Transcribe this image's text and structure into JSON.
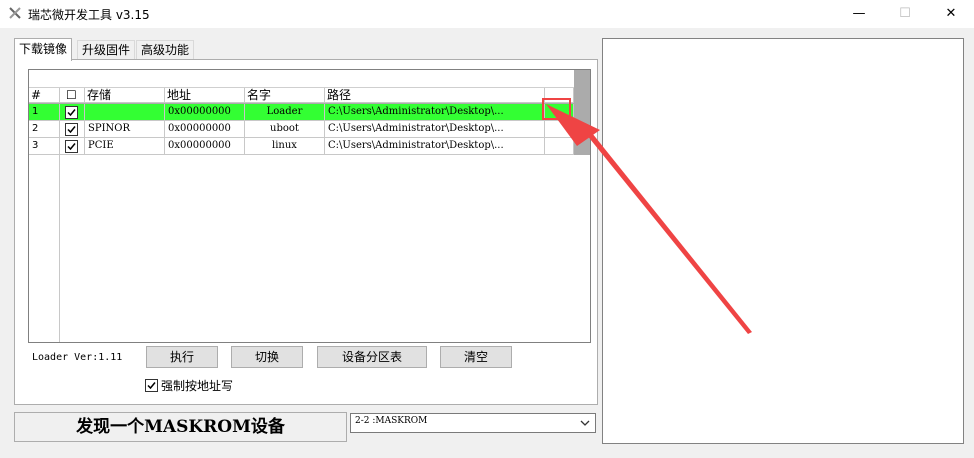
{
  "window": {
    "title": "瑞芯微开发工具 v3.15",
    "minimize": "—",
    "maximize": "☐",
    "close": "✕"
  },
  "tabs": [
    {
      "label": "下载镜像",
      "active": true
    },
    {
      "label": "升级固件",
      "active": false
    },
    {
      "label": "高级功能",
      "active": false
    }
  ],
  "grid": {
    "columns": [
      "#",
      "☐",
      "存储",
      "地址",
      "名字",
      "路径"
    ],
    "rows": [
      {
        "num": "1",
        "checked": true,
        "storage": "",
        "address": "0x00000000",
        "name": "Loader",
        "path": "C:\\Users\\Administrator\\Desktop\\...",
        "selected": true
      },
      {
        "num": "2",
        "checked": true,
        "storage": "SPINOR",
        "address": "0x00000000",
        "name": "uboot",
        "path": "C:\\Users\\Administrator\\Desktop\\...",
        "selected": false
      },
      {
        "num": "3",
        "checked": true,
        "storage": "PCIE",
        "address": "0x00000000",
        "name": "linux",
        "path": "C:\\Users\\Administrator\\Desktop\\...",
        "selected": false
      }
    ]
  },
  "loader_version": "Loader Ver:1.11",
  "buttons": {
    "run": "执行",
    "switch": "切换",
    "partition_table": "设备分区表",
    "clear": "清空"
  },
  "force_write": {
    "label": "强制按地址写",
    "checked": true
  },
  "status": "发现一个MASKROM设备",
  "device_select": {
    "value": "2-2 :MASKROM"
  },
  "colors": {
    "selected_row": "#33ff33",
    "annotation": "#ef4444"
  }
}
